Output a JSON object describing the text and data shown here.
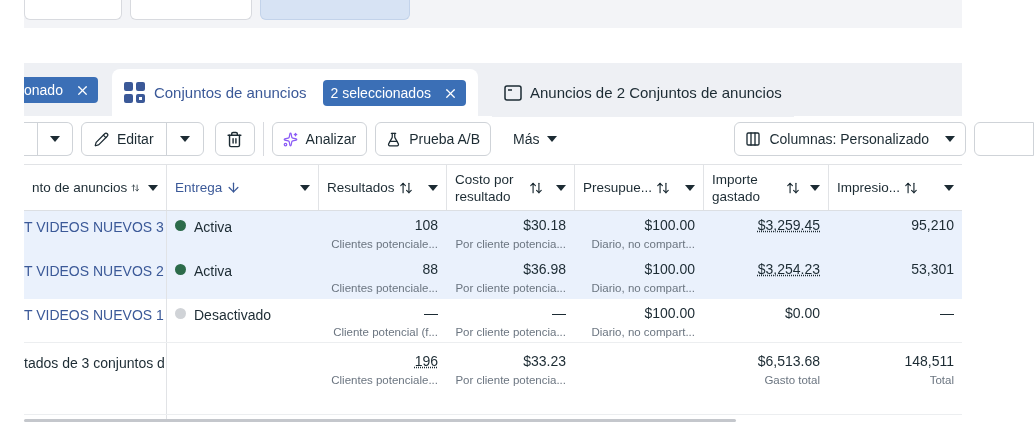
{
  "tabs": [
    {
      "label": "onado",
      "selected": false,
      "kind": "chip"
    },
    {
      "label": "Conjuntos de anuncios",
      "badge": "2 seleccionados",
      "selected": true,
      "kind": "tab"
    },
    {
      "label": "Anuncios de 2 Conjuntos de anuncios",
      "selected": false,
      "kind": "tab"
    }
  ],
  "toolbar": {
    "edit": "Editar",
    "analyze": "Analizar",
    "ab_test": "Prueba A/B",
    "more": "Más",
    "columns": "Columnas: Personalizado"
  },
  "table": {
    "columns": [
      {
        "label": "nto de anuncios",
        "sorted": false
      },
      {
        "label": "Entrega",
        "sorted": true
      },
      {
        "label": "Resultados",
        "sorted": false
      },
      {
        "label": "Costo por resultado",
        "sorted": false
      },
      {
        "label": "Presupue...",
        "sorted": false
      },
      {
        "label": "Importe gastado",
        "sorted": false
      },
      {
        "label": "Impresio...",
        "sorted": false
      }
    ],
    "rows": [
      {
        "name": "T VIDEOS NUEVOS 3",
        "selected": true,
        "active": true,
        "delivery": "Activa",
        "results": "108",
        "results_sub": "Clientes potenciale...",
        "cost": "$30.18",
        "cost_sub": "Por cliente potencia...",
        "budget": "$100.00",
        "budget_sub": "Diario, no compart...",
        "spent": "$3,259.45",
        "impressions": "95,210"
      },
      {
        "name": "T VIDEOS NUEVOS 2",
        "selected": true,
        "active": true,
        "delivery": "Activa",
        "results": "88",
        "results_sub": "Clientes potenciale...",
        "cost": "$36.98",
        "cost_sub": "Por cliente potencia...",
        "budget": "$100.00",
        "budget_sub": "Diario, no compart...",
        "spent": "$3,254.23",
        "impressions": "53,301"
      },
      {
        "name": "T VIDEOS NUEVOS 1",
        "selected": false,
        "active": false,
        "delivery": "Desactivado",
        "results": "—",
        "results_sub": "Cliente potencial (f...",
        "cost": "—",
        "cost_sub": "Por cliente potencia...",
        "budget": "$100.00",
        "budget_sub": "Diario, no compart...",
        "spent": "$0.00",
        "impressions": "—"
      }
    ],
    "summary": {
      "label": "tados de 3 conjuntos d",
      "results": "196",
      "results_sub": "Clientes potenciale...",
      "cost": "$33.23",
      "cost_sub": "Por cliente potencia...",
      "spent": "$6,513.68",
      "spent_sub": "Gasto total",
      "impressions": "148,511",
      "impressions_sub": "Total"
    }
  }
}
